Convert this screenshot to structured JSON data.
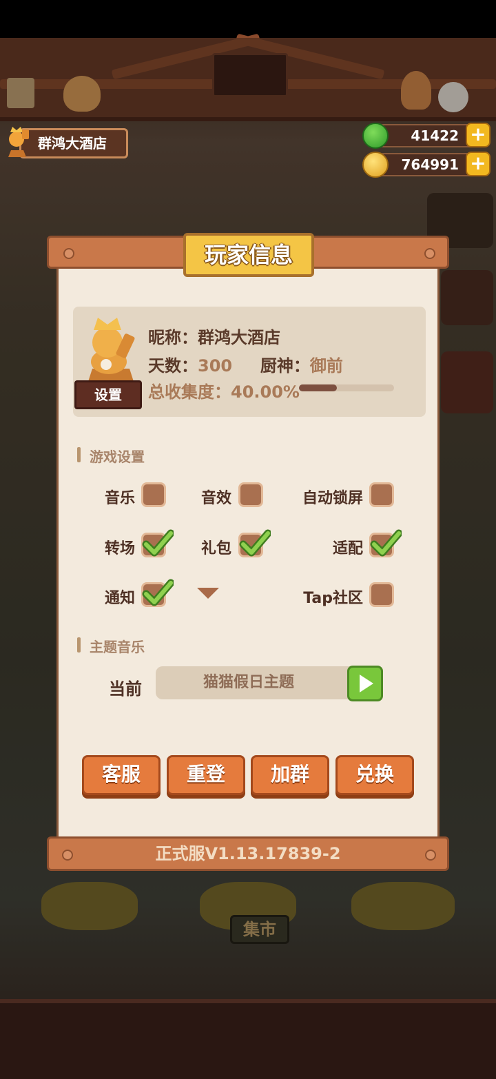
{
  "hud": {
    "restaurant_name": "群鸿大酒店",
    "gems": "41422",
    "coins": "764991",
    "plus_label": "+"
  },
  "background": {
    "market_label": "集市"
  },
  "dialog": {
    "title": "玩家信息",
    "profile": {
      "nickname_label": "昵称：",
      "nickname": "群鸿大酒店",
      "days_label": "天数：",
      "days": "300",
      "chef_label": "厨神：",
      "chef": "御前",
      "collection_label": "总收集度：",
      "collection": "40.00%",
      "collection_fraction": 0.4,
      "settings_button": "设置"
    },
    "game_settings": {
      "section_title": "游戏设置",
      "options": [
        {
          "label": "音乐",
          "checked": false
        },
        {
          "label": "音效",
          "checked": false
        },
        {
          "label": "自动锁屏",
          "checked": false
        },
        {
          "label": "转场",
          "checked": true
        },
        {
          "label": "礼包",
          "checked": true
        },
        {
          "label": "适配",
          "checked": true
        },
        {
          "label": "通知",
          "checked": true
        },
        {
          "label": "",
          "checked": false
        },
        {
          "label": "Tap社区",
          "checked": false
        }
      ]
    },
    "theme_music": {
      "section_title": "主题音乐",
      "current_label": "当前",
      "current_track": "猫猫假日主题"
    },
    "buttons": {
      "support": "客服",
      "relogin": "重登",
      "join_group": "加群",
      "redeem": "兑换"
    },
    "version": "正式服V1.13.17839-2"
  },
  "colors": {
    "accent_orange": "#e57b3d",
    "gold": "#f4c545",
    "check_green": "#79c73b",
    "panel": "#f3eadd"
  }
}
